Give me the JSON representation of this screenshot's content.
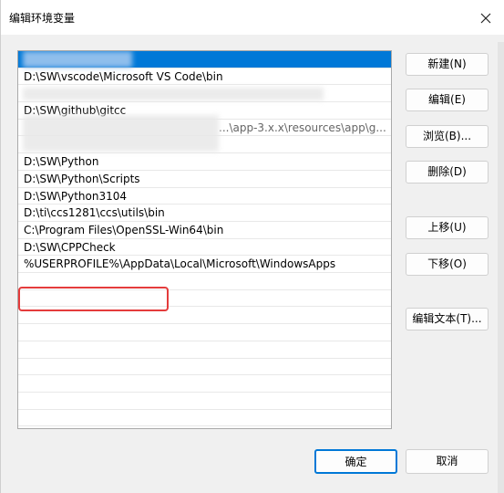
{
  "window": {
    "title": "编辑环境变量",
    "close_icon": "close-icon"
  },
  "list": {
    "rows": [
      "",
      "D:\\SW\\vscode\\Microsoft VS Code\\bin",
      "",
      "D:\\SW\\github\\gitcc",
      "",
      "D:\\SW\\Python",
      "D:\\SW\\Python\\Scripts",
      "D:\\SW\\Python3104",
      "D:\\ti\\ccs1281\\ccs\\utils\\bin",
      "C:\\Program Files\\OpenSSL-Win64\\bin",
      "D:\\SW\\CPPCheck",
      "%USERPROFILE%\\AppData\\Local\\Microsoft\\WindowsApps",
      "",
      "",
      "",
      "",
      "",
      "",
      "",
      "",
      "",
      ""
    ],
    "row3_partial": "...\\app-3.x.x\\resources\\app\\g..."
  },
  "buttons": {
    "new": "新建(N)",
    "edit": "编辑(E)",
    "browse": "浏览(B)...",
    "delete": "删除(D)",
    "move_up": "上移(U)",
    "move_down": "下移(O)",
    "edit_text": "编辑文本(T)...",
    "ok": "确定",
    "cancel": "取消"
  },
  "colors": {
    "selection": "#0078d7",
    "highlight": "#e43c3c"
  }
}
